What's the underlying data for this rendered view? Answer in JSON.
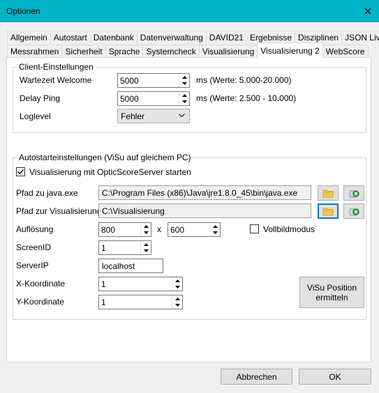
{
  "window": {
    "title": "Optionen"
  },
  "tabs": {
    "row1": [
      "Allgemein",
      "Autostart",
      "Datenbank",
      "Datenverwaltung",
      "DAVID21",
      "Ergebnisse",
      "Disziplinen",
      "JSON Live"
    ],
    "row2": [
      "Messrahmen",
      "Sicherheit",
      "Sprache",
      "Systemcheck",
      "Visualisierung",
      "Visualisierung 2",
      "WebScore"
    ],
    "active": "Visualisierung 2"
  },
  "client": {
    "title": "Client-Einstellungen",
    "wartezeit_label": "Wartezeit Welcome",
    "wartezeit_value": "5000",
    "wartezeit_hint": "ms (Werte: 5.000-20.000)",
    "delay_label": "Delay Ping",
    "delay_value": "5000",
    "delay_hint": "ms (Werte: 2.500 - 10.000)",
    "loglevel_label": "Loglevel",
    "loglevel_value": "Fehler"
  },
  "autostart": {
    "title": "Autostarteinstellungen (ViSu auf gleichem PC)",
    "checkbox_label": "Visualisierung mit OpticScoreServer starten",
    "checkbox_checked": true,
    "java_label": "Pfad zu java.exe",
    "java_value": "C:\\Program Files (x86)\\Java\\jre1.8.0_45\\bin\\java.exe",
    "visu_label": "Pfad zur Visualisierung",
    "visu_value": "C:\\Visualisierung",
    "aufloesung_label": "Auflösung",
    "width_value": "800",
    "x_sep": "x",
    "height_value": "600",
    "vollbild_label": "Vollbildmodus",
    "vollbild_checked": false,
    "screenid_label": "ScreenID",
    "screenid_value": "1",
    "serverip_label": "ServerIP",
    "serverip_value": "localhost",
    "xkoord_label": "X-Koordinate",
    "xkoord_value": "1",
    "ykoord_label": "Y-Koordinate",
    "ykoord_value": "1",
    "position_button": "ViSu Position ermitteln"
  },
  "footer": {
    "cancel_label": "Abbrechen",
    "ok_label": "OK"
  }
}
